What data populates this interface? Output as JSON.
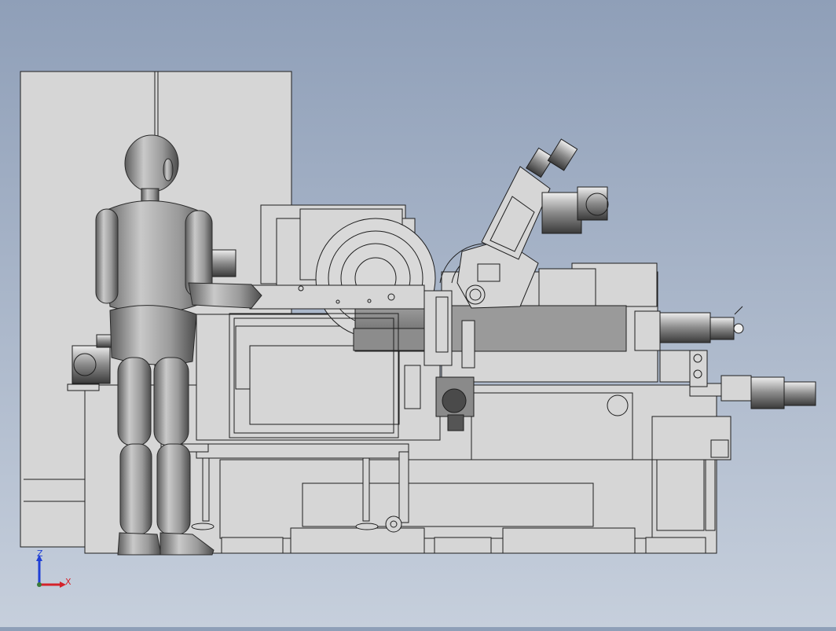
{
  "viewport": {
    "background_top": "#8f9fb8",
    "background_bottom": "#c6cfdc",
    "model_fill": "#d6d6d6",
    "edge_color": "#1e1e1e",
    "shade_dark": "#6e6e6e",
    "human_figure": "human-operator-mannequin"
  },
  "triad": {
    "z_label": "Z",
    "x_label": "X",
    "z_color": "#1f3fd6",
    "x_color": "#d4222a",
    "origin_color": "#3a7a3a"
  }
}
